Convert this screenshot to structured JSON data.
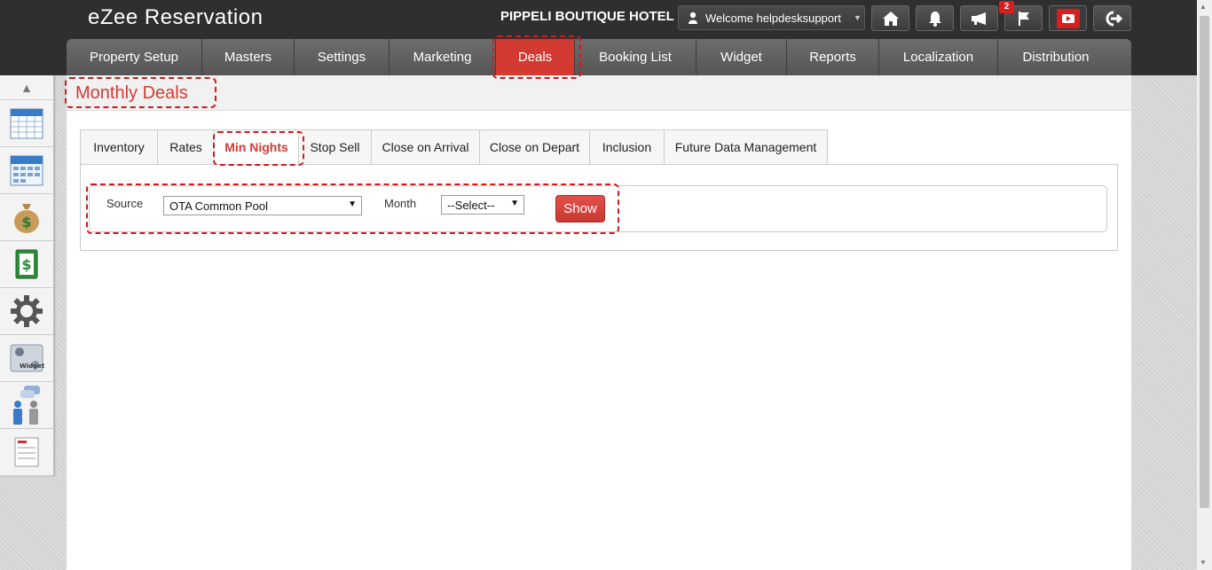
{
  "app": {
    "title": "eZee Reservation"
  },
  "header": {
    "hotel_name": "PIPPELI BOUTIQUE HOTEL",
    "welcome_text": "Welcome helpdesksupport",
    "notification_count": "2",
    "icons": [
      "home-icon",
      "bell-icon",
      "megaphone-icon",
      "flag-icon",
      "youtube-icon",
      "logout-icon"
    ]
  },
  "nav": {
    "items": [
      {
        "label": "Property Setup"
      },
      {
        "label": "Masters"
      },
      {
        "label": "Settings"
      },
      {
        "label": "Marketing"
      },
      {
        "label": "Deals"
      },
      {
        "label": "Booking List"
      },
      {
        "label": "Widget"
      },
      {
        "label": "Reports"
      },
      {
        "label": "Localization"
      },
      {
        "label": "Distribution"
      }
    ],
    "active": "Deals"
  },
  "sidebar": {
    "items": [
      "calendar-icon",
      "calendar-2005-icon",
      "money-bag-icon",
      "cash-icon",
      "settings-gear-icon",
      "widget-icon",
      "users-chat-icon",
      "task-list-icon"
    ]
  },
  "page": {
    "title": "Monthly Deals"
  },
  "tabs": {
    "items": [
      {
        "label": "Inventory"
      },
      {
        "label": "Rates"
      },
      {
        "label": "Min Nights"
      },
      {
        "label": "Stop Sell"
      },
      {
        "label": "Close on Arrival"
      },
      {
        "label": "Close on Depart"
      },
      {
        "label": "Inclusion"
      },
      {
        "label": "Future Data Management"
      }
    ],
    "active": "Min Nights"
  },
  "filter": {
    "source_label": "Source",
    "source_value": "OTA Common Pool",
    "month_label": "Month",
    "month_value": "--Select--",
    "show_label": "Show"
  },
  "colors": {
    "accent": "#d33a32",
    "topbar": "#2f2f2f",
    "highlight": "#d01c1c"
  }
}
